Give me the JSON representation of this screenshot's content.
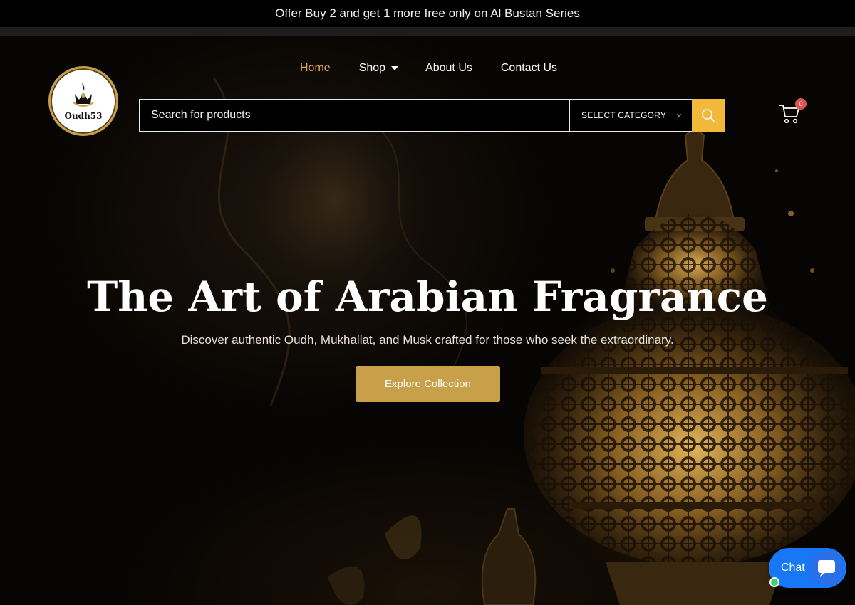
{
  "announcement": {
    "text": "Offer Buy 2 and get 1 more free only on Al Bustan Series"
  },
  "logo": {
    "text": "Oudh53",
    "icon": "crown-incense-logo-icon"
  },
  "nav": {
    "items": [
      {
        "label": "Home",
        "active": true
      },
      {
        "label": "Shop",
        "has_dropdown": true
      },
      {
        "label": "About Us"
      },
      {
        "label": "Contact Us"
      }
    ]
  },
  "search": {
    "placeholder": "Search for products",
    "value": "",
    "category_label": "SELECT CATEGORY",
    "button_icon": "search-icon"
  },
  "cart": {
    "icon": "cart-icon",
    "count": "0"
  },
  "hero": {
    "title": "The Art of Arabian Fragrance",
    "subtitle": "Discover authentic Oudh, Mukhallat, and Musk crafted for those who seek the extraordinary.",
    "cta_label": "Explore Collection"
  },
  "chat": {
    "label": "Chat",
    "icon": "chat-bubble-icon",
    "status": "online"
  },
  "colors": {
    "accent_gold": "#c9a04a",
    "nav_active": "#e0a94a",
    "search_button": "#f1b83a",
    "cart_badge": "#d9534f",
    "chat_blue": "#1877f2",
    "online_green": "#3bd16f"
  }
}
